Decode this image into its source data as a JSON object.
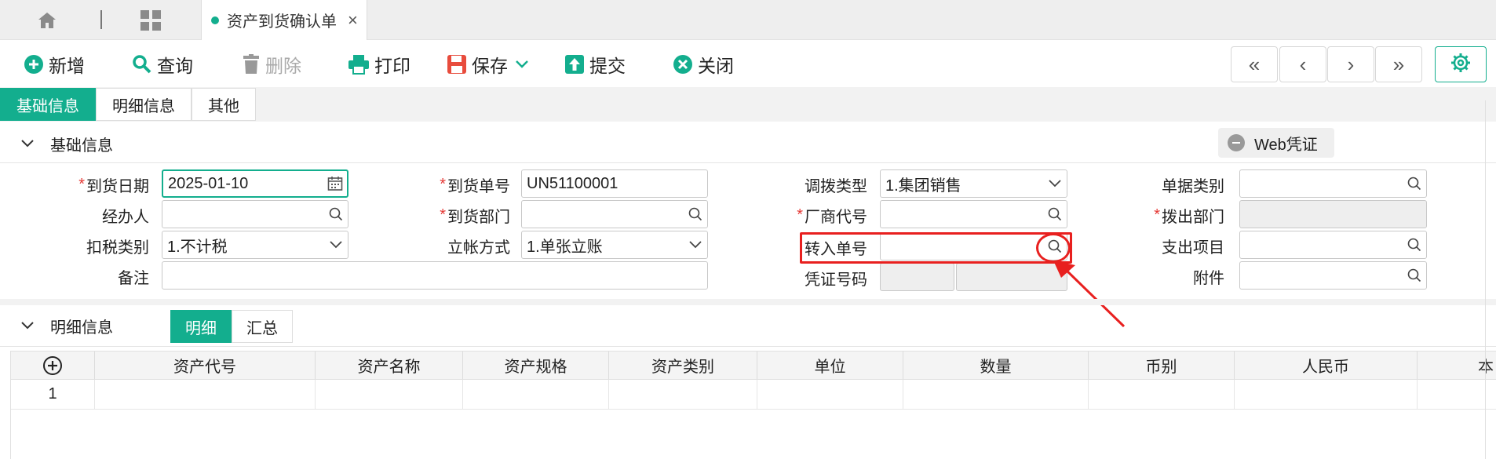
{
  "tabs": {
    "document_tab": "资产到货确认单",
    "close_glyph": "×"
  },
  "toolbar": {
    "add": "新增",
    "query": "查询",
    "delete": "删除",
    "print": "打印",
    "save": "保存",
    "submit": "提交",
    "close": "关闭"
  },
  "nav": {
    "first": "«",
    "prev": "‹",
    "next": "›",
    "last": "»"
  },
  "section_tabs": [
    "基础信息",
    "明细信息",
    "其他"
  ],
  "basic_section": {
    "title": "基础信息",
    "web_voucher": "Web凭证"
  },
  "form": {
    "arrival_date": {
      "label": "到货日期",
      "value": "2025-01-10",
      "required": true
    },
    "arrival_no": {
      "label": "到货单号",
      "value": "UN51100001",
      "required": true
    },
    "transfer_type": {
      "label": "调拨类型",
      "value": "1.集团销售"
    },
    "doc_category": {
      "label": "单据类别",
      "value": ""
    },
    "handler": {
      "label": "经办人",
      "value": ""
    },
    "arrival_dept": {
      "label": "到货部门",
      "value": "",
      "required": true
    },
    "vendor_code": {
      "label": "厂商代号",
      "value": "",
      "required": true
    },
    "out_dept": {
      "label": "拨出部门",
      "value": "",
      "required": true
    },
    "tax_type": {
      "label": "扣税类别",
      "value": "1.不计税"
    },
    "account_method": {
      "label": "立帐方式",
      "value": "1.单张立账"
    },
    "transfer_in_no": {
      "label": "转入单号",
      "value": ""
    },
    "expense_item": {
      "label": "支出项目",
      "value": ""
    },
    "remark": {
      "label": "备注",
      "value": ""
    },
    "voucher_no": {
      "label": "凭证号码",
      "value": ""
    },
    "attachment": {
      "label": "附件",
      "value": ""
    }
  },
  "detail_section": {
    "title": "明细信息",
    "tab_detail": "明细",
    "tab_summary": "汇总"
  },
  "grid": {
    "columns": [
      "资产代号",
      "资产名称",
      "资产规格",
      "资产类别",
      "单位",
      "数量",
      "币别",
      "人民币",
      "本"
    ],
    "rows": [
      [
        "1",
        "",
        "",
        "",
        "",
        "",
        "",
        "",
        "",
        ""
      ]
    ]
  },
  "colors": {
    "accent": "#13ae8e",
    "annotation": "#e8201f",
    "required": "#e53935"
  }
}
